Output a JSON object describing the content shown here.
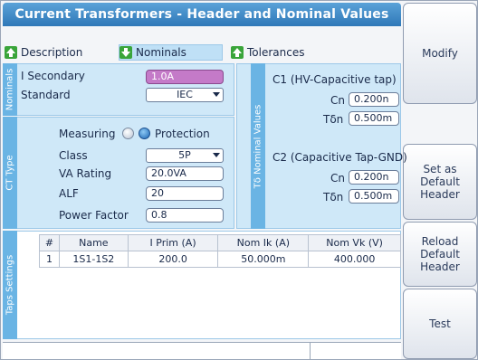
{
  "window": {
    "title": "Current Transformers - Header and Nominal Values"
  },
  "side_buttons": {
    "modify": "Modify",
    "set_default": "Set as Default Header",
    "reload_default": "Reload Default Header",
    "test": "Test"
  },
  "tabs": [
    {
      "label": "Description",
      "icon": "arrow-up-icon",
      "active": false
    },
    {
      "label": "Nominals",
      "icon": "arrow-down-icon",
      "active": true
    },
    {
      "label": "Tolerances",
      "icon": "arrow-up-icon",
      "active": false
    }
  ],
  "section_labels": {
    "nominals": "Nominals",
    "ct_type": "CT Type",
    "taps_settings": "Taps Settings",
    "td_nominal": "Tδ Nominal Values"
  },
  "nominals": {
    "i_secondary_label": "I Secondary",
    "i_secondary_value": "1.0A",
    "standard_label": "Standard",
    "standard_value": "IEC"
  },
  "ct_type": {
    "measuring_label": "Measuring",
    "protection_label": "Protection",
    "selected": "Protection",
    "class_label": "Class",
    "class_value": "5P",
    "va_rating_label": "VA Rating",
    "va_rating_value": "20.0VA",
    "alf_label": "ALF",
    "alf_value": "20",
    "power_factor_label": "Power Factor",
    "power_factor_value": "0.8"
  },
  "td_nominal": {
    "c1_title": "C1 (HV-Capacitive tap)",
    "c1_cn_label": "Cn",
    "c1_cn_value": "0.200n",
    "c1_td_label": "Tδn",
    "c1_td_value": "0.500m",
    "c2_title": "C2 (Capacitive Tap-GND)",
    "c2_cn_label": "Cn",
    "c2_cn_value": "0.200n",
    "c2_td_label": "Tδn",
    "c2_td_value": "0.500m"
  },
  "taps_table": {
    "headers": [
      "#",
      "Name",
      "I Prim (A)",
      "Nom Ik (A)",
      "Nom Vk (V)"
    ],
    "rows": [
      [
        "1",
        "1S1-1S2",
        "200.0",
        "50.000m",
        "400.000"
      ]
    ]
  },
  "colors": {
    "title_bar": "#2f78b8",
    "panel_bg": "#cfe8f8",
    "vertical_label_bg": "#6ab4e4",
    "highlight_field": "#c47ac8",
    "arrow_green": "#3aa53a"
  }
}
